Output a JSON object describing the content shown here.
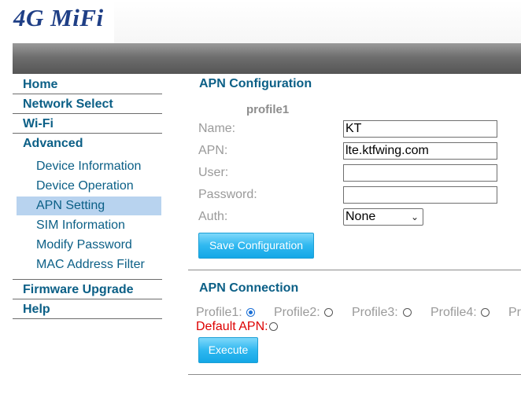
{
  "header": {
    "logo": "4G MiFi"
  },
  "sidebar": {
    "home": "Home",
    "network_select": "Network Select",
    "wifi": "Wi-Fi",
    "advanced": "Advanced",
    "sub_items": [
      {
        "label": "Device Information"
      },
      {
        "label": "Device Operation"
      },
      {
        "label": "APN Setting",
        "active": true
      },
      {
        "label": "SIM Information"
      },
      {
        "label": "Modify Password"
      },
      {
        "label": "MAC Address Filter"
      }
    ],
    "firmware_upgrade": "Firmware Upgrade",
    "help": "Help"
  },
  "apn_config": {
    "title": "APN Configuration",
    "profile_name": "profile1",
    "name_label": "Name:",
    "name_value": "KT",
    "apn_label": "APN:",
    "apn_value": "lte.ktfwing.com",
    "user_label": "User:",
    "user_value": "",
    "password_label": "Password:",
    "password_value": "",
    "auth_label": "Auth:",
    "auth_value": "None",
    "save_button": "Save Configuration"
  },
  "apn_connection": {
    "title": "APN Connection",
    "profiles": [
      {
        "label": "Profile1:",
        "checked": true
      },
      {
        "label": "Profile2:",
        "checked": false
      },
      {
        "label": "Profile3:",
        "checked": false
      },
      {
        "label": "Profile4:",
        "checked": false
      },
      {
        "label": "Pr",
        "checked": false
      }
    ],
    "default_apn_label": "Default APN:",
    "execute_button": "Execute"
  },
  "colors": {
    "nav_text": "#0b5f86",
    "active_bg": "#b8d3ef",
    "button_blue": "#2fb8f0",
    "default_apn_red": "#dd0000",
    "radio_checked": "#1a6fd6"
  }
}
